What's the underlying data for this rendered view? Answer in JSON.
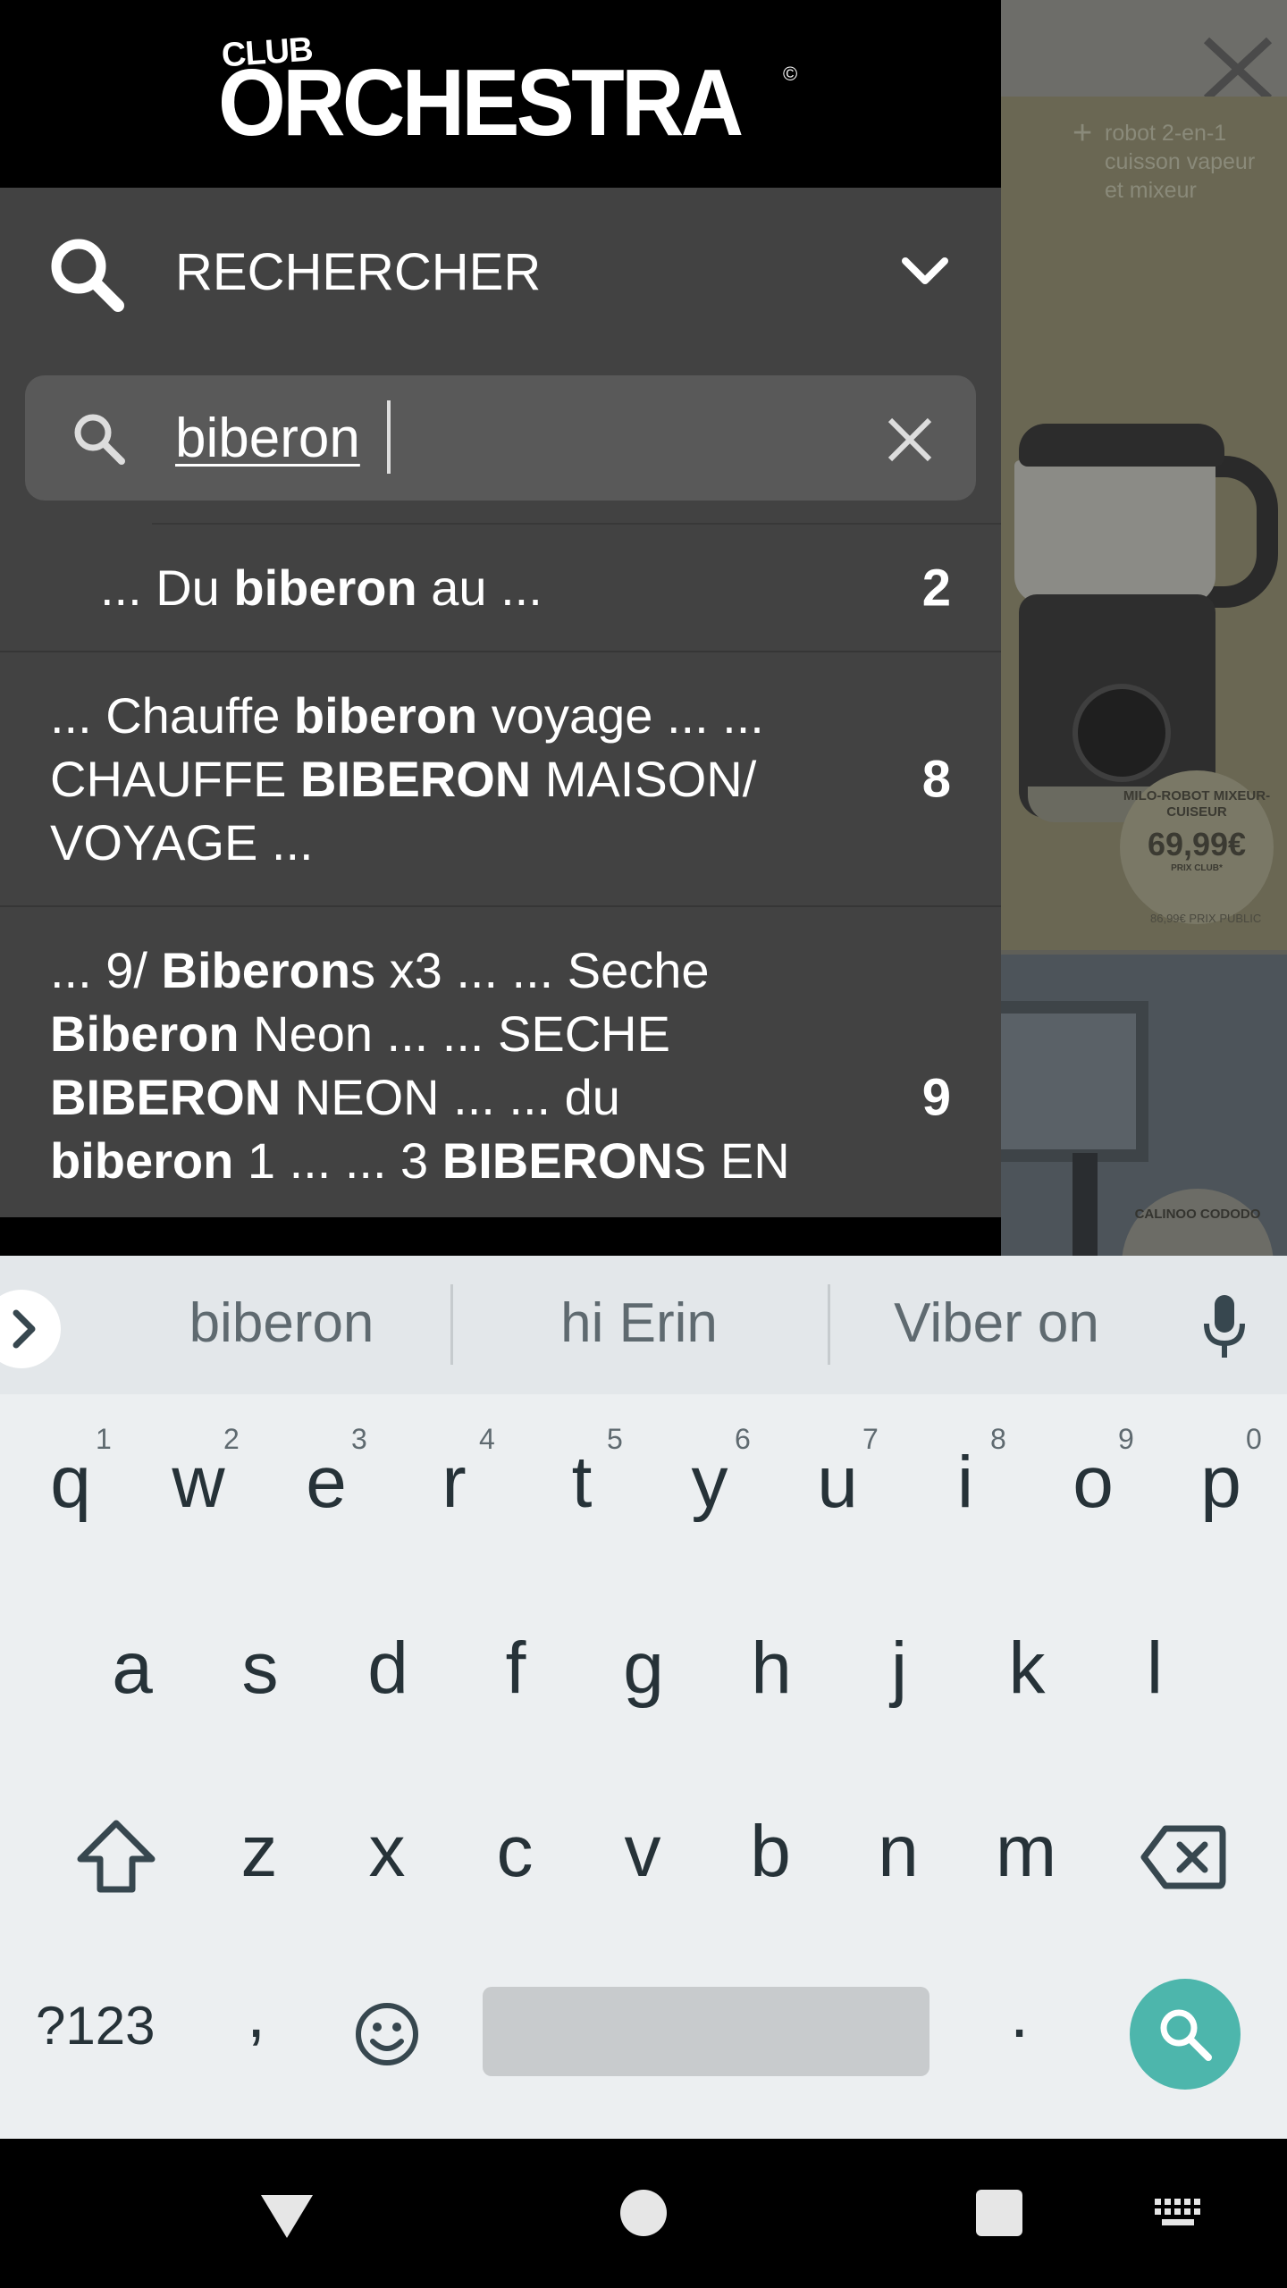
{
  "background_catalog": {
    "promo_text": "robot 2-en-1 cuisson vapeur et mixeur",
    "product1_name": "MILO-ROBOT MIXEUR-CUISEUR",
    "product1_price": "69,99€",
    "product1_price_label": "PRIX CLUB*",
    "product1_public_price": "86,99€ PRIX PUBLIC",
    "product2_name": "CALINOO CODODO"
  },
  "menu": {
    "logo_small": "CLUB",
    "logo_main": "ORCHESTRA",
    "logo_reg": "©",
    "search_title": "RECHERCHER",
    "search_value": "biberon"
  },
  "results": [
    {
      "parts": [
        [
          "... Du ",
          false
        ],
        [
          "biberon",
          true
        ],
        [
          " au ...",
          false
        ]
      ],
      "count": "2"
    },
    {
      "parts": [
        [
          "... Chauffe ",
          false
        ],
        [
          "biberon",
          true
        ],
        [
          " voyage ... ... CHAUFFE ",
          false
        ],
        [
          "BIBERON",
          true
        ],
        [
          " MAISON/ VOYAGE ...",
          false
        ]
      ],
      "count": "8"
    },
    {
      "parts": [
        [
          "... 9/ ",
          false
        ],
        [
          "Biberon",
          true
        ],
        [
          "s x3 ... ... Seche ",
          false
        ],
        [
          "Biberon",
          true
        ],
        [
          " Neon ... ... SECHE ",
          false
        ],
        [
          "BIBERON",
          true
        ],
        [
          " NEON ... ... du ",
          false
        ],
        [
          "biberon",
          true
        ],
        [
          " 1 ... ... 3 ",
          false
        ],
        [
          "BIBERON",
          true
        ],
        [
          "S EN ...",
          false
        ]
      ],
      "count": "9"
    }
  ],
  "keyboard": {
    "suggestions": [
      "biberon",
      "hi Erin",
      "Viber on"
    ],
    "row1": [
      "q",
      "w",
      "e",
      "r",
      "t",
      "y",
      "u",
      "i",
      "o",
      "p"
    ],
    "row1_hints": [
      "1",
      "2",
      "3",
      "4",
      "5",
      "6",
      "7",
      "8",
      "9",
      "0"
    ],
    "row2": [
      "a",
      "s",
      "d",
      "f",
      "g",
      "h",
      "j",
      "k",
      "l"
    ],
    "row3": [
      "z",
      "x",
      "c",
      "v",
      "b",
      "n",
      "m"
    ],
    "symbols_label": "?123",
    "comma": ",",
    "period": "."
  },
  "colors": {
    "menu_bg": "#424242",
    "header_bg": "#000000",
    "search_box_bg": "#595959",
    "keyboard_bg": "#eceff1",
    "action_button": "#4db6ac"
  }
}
